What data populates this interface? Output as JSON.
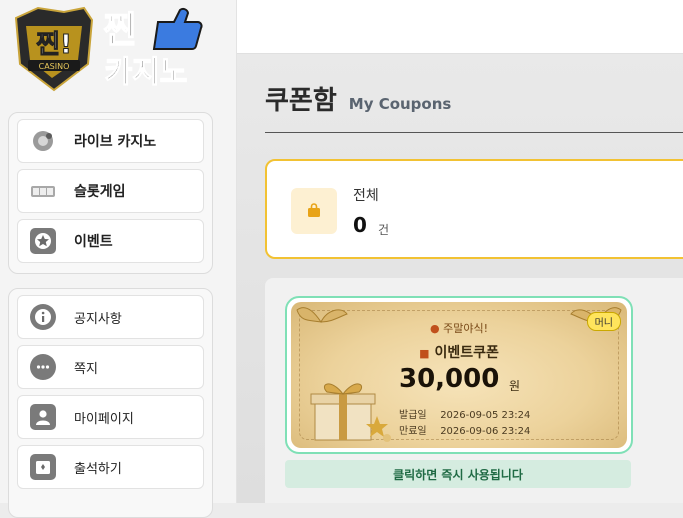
{
  "logo": {
    "line1": "찐!",
    "line2": "찐",
    "line3": "카지노",
    "emblem_text": "CASINO"
  },
  "sidebar": {
    "group1": [
      {
        "label": "라이브 카지노",
        "icon": "roulette-icon"
      },
      {
        "label": "슬롯게임",
        "icon": "slot-icon"
      },
      {
        "label": "이벤트",
        "icon": "star-icon"
      }
    ],
    "group2": [
      {
        "label": "공지사항",
        "icon": "info-icon"
      },
      {
        "label": "쪽지",
        "icon": "chat-icon"
      },
      {
        "label": "마이페이지",
        "icon": "user-icon"
      },
      {
        "label": "출석하기",
        "icon": "calendar-icon"
      }
    ]
  },
  "page": {
    "title": "쿠폰함",
    "subtitle": "My Coupons"
  },
  "summary": {
    "label": "전체",
    "value": "0",
    "unit": "건",
    "icon": "bag-icon"
  },
  "coupon": {
    "badge": "머니",
    "tag": "주말야식!",
    "name": "이벤트쿠폰",
    "amount": "30,000",
    "currency": "원",
    "issued_label": "발급일",
    "issued": "2026-09-05 23:24",
    "expires_label": "만료일",
    "expires": "2026-09-06 23:24",
    "action": "클릭하면 즉시 사용됩니다"
  },
  "colors": {
    "accent": "#f2c233",
    "coupon_border": "#7fe0b6",
    "action_text": "#1f6a44"
  }
}
